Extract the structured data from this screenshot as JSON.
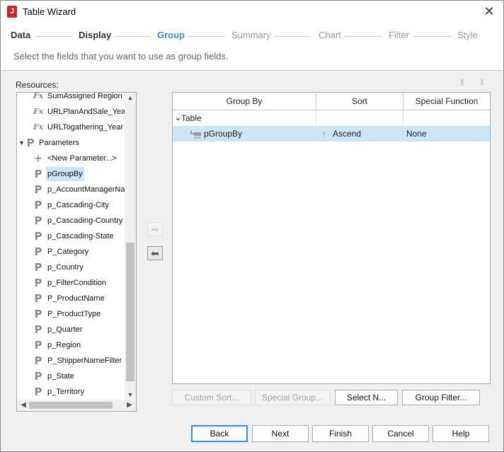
{
  "window": {
    "title": "Table Wizard",
    "app_icon_letter": "J",
    "close_glyph": "✕"
  },
  "steps": [
    "Data",
    "Display",
    "Group",
    "Summary",
    "Chart",
    "Filter",
    "Style"
  ],
  "instruction": "Select the fields that you want to use as group fields.",
  "resources": {
    "label": "Resources:",
    "items": [
      {
        "icon": "function-icon",
        "glyph": "Fx",
        "label": "SumAssigned Region"
      },
      {
        "icon": "function-icon",
        "glyph": "Fx",
        "label": "URLPlanAndSale_Year"
      },
      {
        "icon": "function-icon",
        "glyph": "Fx",
        "label": "URLTogathering_Year"
      },
      {
        "icon": "parameter-icon",
        "glyph": "P",
        "label": "Parameters",
        "expanded": true
      },
      {
        "icon": "plus-icon",
        "glyph": "+",
        "label": "<New Parameter...>"
      },
      {
        "icon": "parameter-icon",
        "glyph": "P",
        "label": "pGroupBy",
        "selected": true
      },
      {
        "icon": "parameter-icon",
        "glyph": "P",
        "label": "p_AccountManagerName"
      },
      {
        "icon": "parameter-icon",
        "glyph": "P",
        "label": "p_Cascading-City"
      },
      {
        "icon": "parameter-icon",
        "glyph": "P",
        "label": "p_Cascading-Country"
      },
      {
        "icon": "parameter-icon",
        "glyph": "P",
        "label": "p_Cascading-State"
      },
      {
        "icon": "parameter-icon",
        "glyph": "P",
        "label": "P_Category"
      },
      {
        "icon": "parameter-icon",
        "glyph": "P",
        "label": "p_Country"
      },
      {
        "icon": "parameter-icon",
        "glyph": "P",
        "label": "p_FilterCondition"
      },
      {
        "icon": "parameter-icon",
        "glyph": "P",
        "label": "P_ProductName"
      },
      {
        "icon": "parameter-icon",
        "glyph": "P",
        "label": "P_ProductType"
      },
      {
        "icon": "parameter-icon",
        "glyph": "P",
        "label": "p_Quarter"
      },
      {
        "icon": "parameter-icon",
        "glyph": "P",
        "label": "p_Region"
      },
      {
        "icon": "parameter-icon",
        "glyph": "P",
        "label": "P_ShipperNameFilter"
      },
      {
        "icon": "parameter-icon",
        "glyph": "P",
        "label": "p_State"
      },
      {
        "icon": "parameter-icon",
        "glyph": "P",
        "label": "p_Territory"
      }
    ]
  },
  "move": {
    "add_glyph": "➡",
    "remove_glyph": "⬅"
  },
  "order": {
    "up_glyph": "⬆",
    "down_glyph": "⬇"
  },
  "grid": {
    "columns": [
      "Group By",
      "Sort",
      "Special Function"
    ],
    "root": {
      "label": "Table",
      "chevron": "⌄"
    },
    "rows": [
      {
        "group_by": "pGroupBy",
        "sort_glyph": "↑",
        "sort": "Ascend",
        "special": "None"
      }
    ]
  },
  "field_buttons": {
    "custom_sort": "Custom Sort...",
    "special_group": "Special Group...",
    "select_n": "Select N...",
    "group_filter": "Group Filter..."
  },
  "nav": {
    "back": "Back",
    "next": "Next",
    "finish": "Finish",
    "cancel": "Cancel",
    "help": "Help"
  }
}
